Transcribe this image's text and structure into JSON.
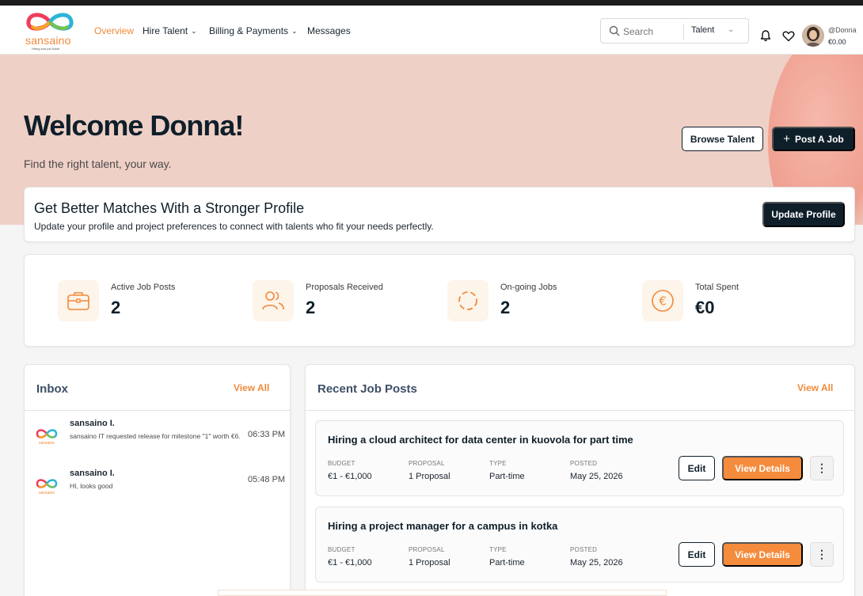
{
  "brand": {
    "name": "sansaino",
    "tagline": "Hiring and job ticket",
    "logo_colors": [
      "#f03c5a",
      "#f5a623",
      "#2bb5d8",
      "#7ac143"
    ]
  },
  "nav": {
    "overview": "Overview",
    "hire_talent": "Hire Talent",
    "billing": "Billing & Payments",
    "messages": "Messages"
  },
  "search": {
    "placeholder": "Search",
    "category": "Talent"
  },
  "user": {
    "handle": "@Donna",
    "balance": "€0.00"
  },
  "hero": {
    "title": "Welcome Donna!",
    "subtitle": "Find the right talent, your way.",
    "browse_label": "Browse Talent",
    "post_label": "Post A Job"
  },
  "profile_banner": {
    "title": "Get Better Matches With a Stronger Profile",
    "description": "Update your profile and project preferences to connect with talents who fit your needs perfectly.",
    "button": "Update Profile"
  },
  "stats": [
    {
      "label": "Active Job Posts",
      "value": "2",
      "icon": "briefcase-icon"
    },
    {
      "label": "Proposals Received",
      "value": "2",
      "icon": "users-icon"
    },
    {
      "label": "On-going Jobs",
      "value": "2",
      "icon": "progress-icon"
    },
    {
      "label": "Total Spent",
      "value": "€0",
      "icon": "euro-icon"
    }
  ],
  "inbox": {
    "title": "Inbox",
    "view_all": "View All",
    "messages": [
      {
        "sender": "sansaino I.",
        "text": "sansaino IT requested release for milestone \"1\" worth €6.",
        "time": "06:33 PM"
      },
      {
        "sender": "sansaino I.",
        "text": "HI, looks good",
        "time": "05:48 PM"
      }
    ]
  },
  "jobs": {
    "title": "Recent Job Posts",
    "view_all": "View All",
    "labels": {
      "budget": "BUDGET",
      "proposal": "PROPOSAL",
      "type": "TYPE",
      "posted": "POSTED"
    },
    "edit_label": "Edit",
    "view_label": "View Details",
    "more_label": "⋮",
    "items": [
      {
        "title": "Hiring a cloud architect for data center in kuovola for part time",
        "budget": "€1 - €1,000",
        "proposal": "1 Proposal",
        "type": "Part-time",
        "posted": "May 25, 2026"
      },
      {
        "title": "Hiring a project manager for a campus in kotka",
        "budget": "€1 - €1,000",
        "proposal": "1 Proposal",
        "type": "Part-time",
        "posted": "May 25, 2026"
      }
    ]
  },
  "colors": {
    "accent": "#f08a3a",
    "dark": "#0f1f2a",
    "hero_bg": "#efd0c6"
  }
}
